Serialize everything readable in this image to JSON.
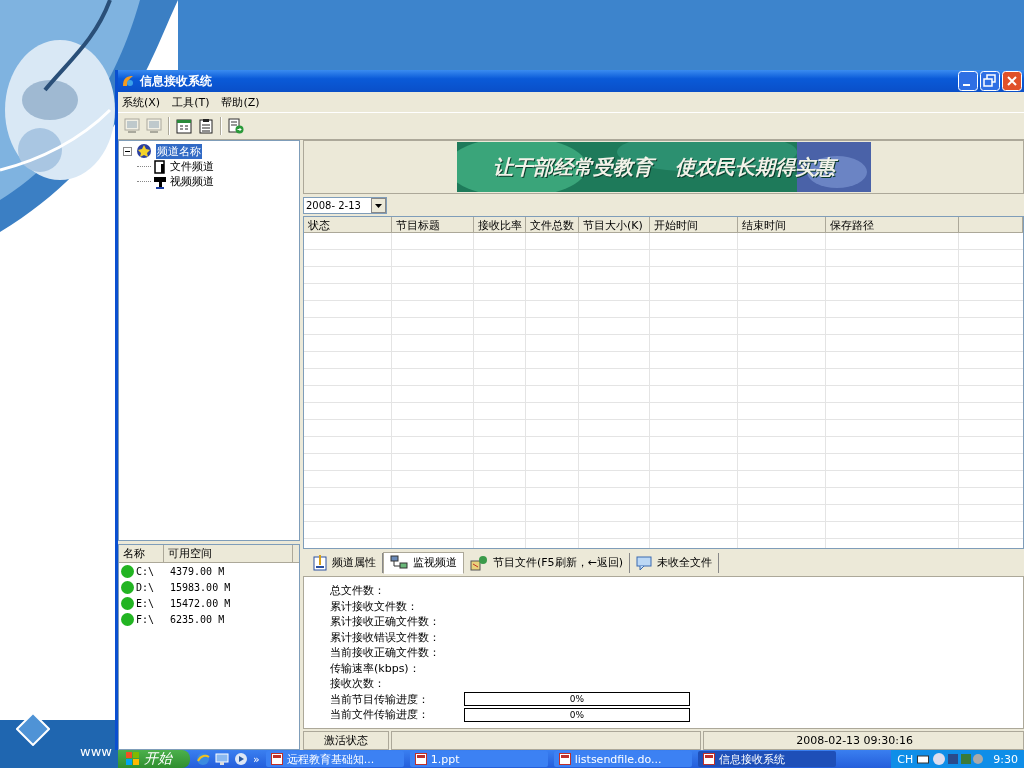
{
  "slide": {
    "footer_text": "www"
  },
  "window": {
    "title": "信息接收系统"
  },
  "menu": [
    {
      "label": "系统(X)"
    },
    {
      "label": "工具(T)"
    },
    {
      "label": "帮助(Z)"
    }
  ],
  "toolbar": [
    {
      "kind": "monitor",
      "disabled": true
    },
    {
      "kind": "monitor",
      "disabled": true
    },
    {
      "kind": "separator"
    },
    {
      "kind": "calendar",
      "disabled": false
    },
    {
      "kind": "clipboard",
      "disabled": false
    },
    {
      "kind": "separator"
    },
    {
      "kind": "export",
      "disabled": false
    }
  ],
  "tree": {
    "label": "频道名称",
    "selected": true,
    "expanded": true,
    "children": [
      {
        "label": "文件频道",
        "kind": "file"
      },
      {
        "label": "视频频道",
        "kind": "video"
      }
    ]
  },
  "drives": {
    "columns": [
      "名称",
      "可用空间"
    ],
    "rows": [
      {
        "name": "C:\\",
        "space": "4379.00 M",
        "color": "#22b422"
      },
      {
        "name": "D:\\",
        "space": "15983.00 M",
        "color": "#22b422"
      },
      {
        "name": "E:\\",
        "space": "15472.00 M",
        "color": "#22b422"
      },
      {
        "name": "F:\\",
        "space": "6235.00 M",
        "color": "#22b422"
      }
    ]
  },
  "banner": {
    "slogans": [
      "让干部经常受教育",
      "使农民长期得实惠"
    ]
  },
  "date_picker": {
    "value": "2008- 2-13"
  },
  "table": {
    "columns": [
      "状态",
      "节目标题",
      "接收比率",
      "文件总数",
      "节目大小(K)",
      "开始时间",
      "结束时间",
      "保存路径"
    ]
  },
  "tabs": [
    {
      "label": "频道属性",
      "kind": "properties",
      "selected": false
    },
    {
      "label": "监视频道",
      "kind": "monitor",
      "selected": true
    },
    {
      "label": "节目文件(F5刷新，←返回)",
      "kind": "files",
      "selected": false
    },
    {
      "label": "未收全文件",
      "kind": "chat",
      "selected": false
    }
  ],
  "stats": [
    {
      "label": "总文件数：",
      "kind": "text"
    },
    {
      "label": "累计接收文件数：",
      "kind": "text"
    },
    {
      "label": "累计接收正确文件数：",
      "kind": "text"
    },
    {
      "label": "累计接收错误文件数：",
      "kind": "text"
    },
    {
      "label": "当前接收正确文件数：",
      "kind": "text"
    },
    {
      "label": "传输速率(kbps)：",
      "kind": "text"
    },
    {
      "label": "接收次数：",
      "kind": "text"
    },
    {
      "label": "当前节目传输进度：",
      "kind": "progress",
      "level": 0,
      "reading": "0%"
    },
    {
      "label": "当前文件传输进度：",
      "kind": "progress",
      "level": 0,
      "reading": "0%"
    }
  ],
  "status_bar": [
    "激活状态",
    "2008-02-13 09:30:16"
  ],
  "taskbar": {
    "start": "开始",
    "more": "»",
    "tasks": [
      {
        "label": "远程教育基础知...",
        "selected": false
      },
      {
        "label": "1.ppt",
        "selected": false
      },
      {
        "label": "listsendfile.do...",
        "selected": false
      },
      {
        "label": "信息接收系统",
        "selected": true
      }
    ],
    "language": "CH",
    "time": "9:30"
  }
}
